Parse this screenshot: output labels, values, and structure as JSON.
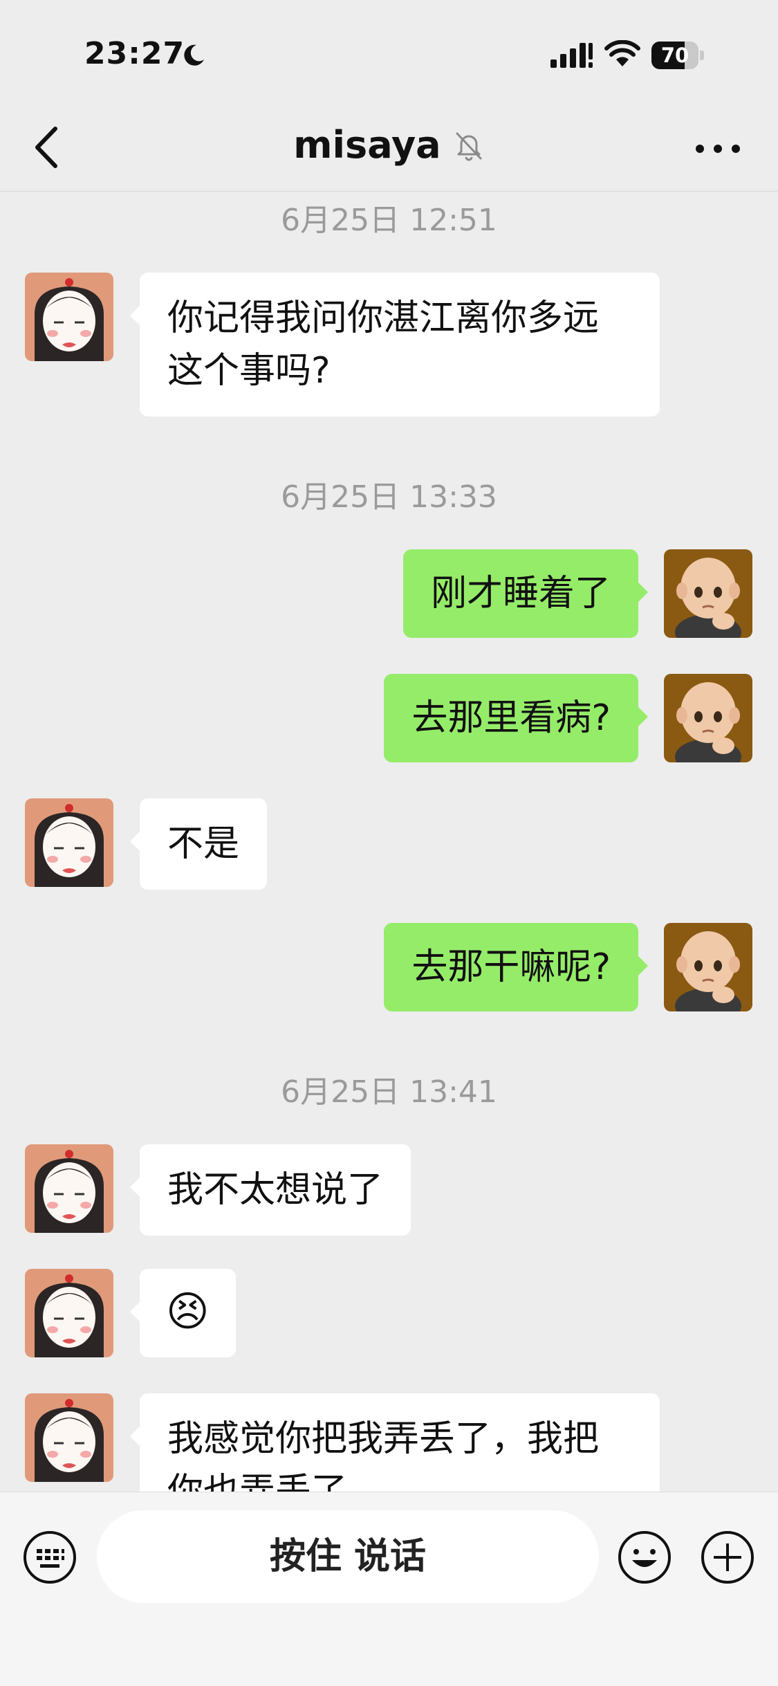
{
  "status_bar": {
    "time": "23:27",
    "battery": "70",
    "battery_level": 0.7
  },
  "header": {
    "title": "misaya"
  },
  "messages": [
    {
      "type": "timestamp",
      "text": "6月25日 12:51"
    },
    {
      "type": "message",
      "side": "left",
      "text": "你记得我问你湛江离你多远这个事吗?"
    },
    {
      "type": "timestamp",
      "text": "6月25日 13:33"
    },
    {
      "type": "message",
      "side": "right",
      "text": "刚才睡着了"
    },
    {
      "type": "message",
      "side": "right",
      "text": "去那里看病?"
    },
    {
      "type": "message",
      "side": "left",
      "text": "不是"
    },
    {
      "type": "message",
      "side": "right",
      "text": "去那干嘛呢?"
    },
    {
      "type": "timestamp",
      "text": "6月25日 13:41"
    },
    {
      "type": "message",
      "side": "left",
      "text": "我不太想说了"
    },
    {
      "type": "message",
      "side": "left",
      "text": "😣"
    },
    {
      "type": "message",
      "side": "left",
      "text": "我感觉你把我弄丢了，我把你也弄丢了"
    }
  ],
  "input_bar": {
    "talk_label": "按住 说话"
  },
  "icons": {
    "back": "chevron-left-icon",
    "mute": "bell-slash-icon",
    "more": "more-dots-icon",
    "keyboard": "keyboard-icon",
    "emoji": "smile-icon",
    "plus": "plus-circle-icon"
  },
  "colors": {
    "self_bubble": "#95ec69",
    "other_bubble": "#ffffff",
    "background": "#ededed"
  }
}
